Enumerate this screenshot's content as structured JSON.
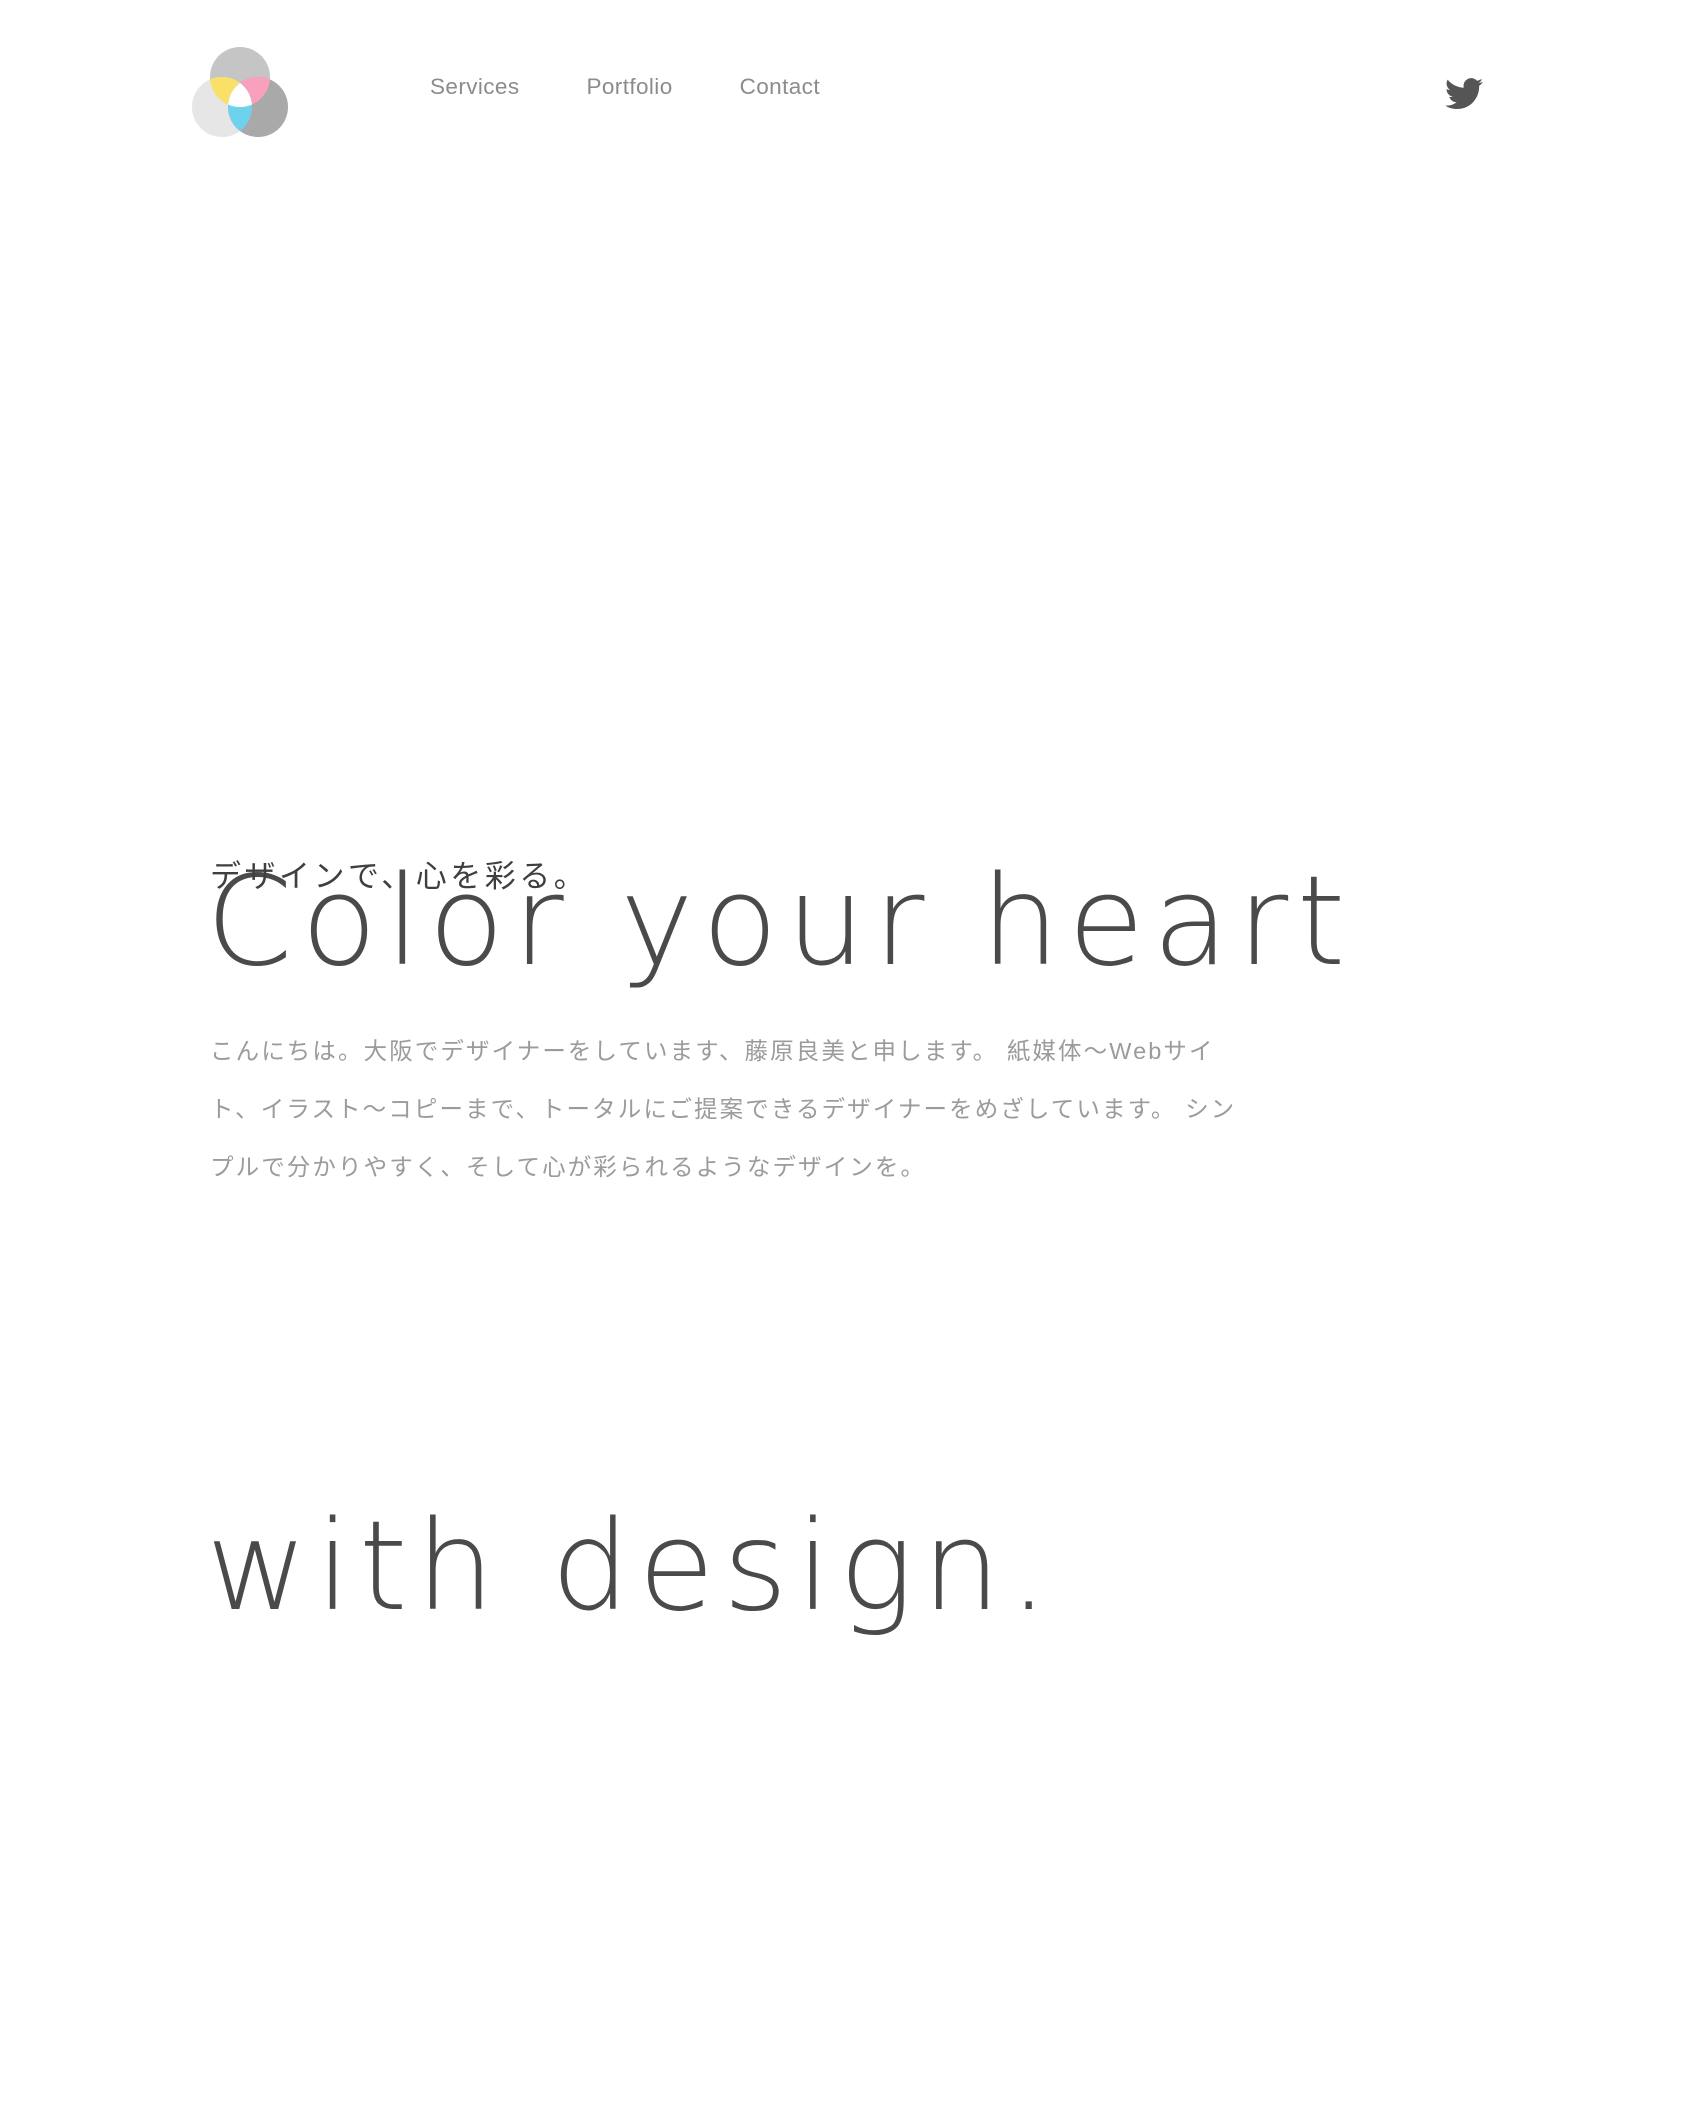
{
  "header": {
    "logo": {
      "name": "venn-circles-logo",
      "colors": {
        "circle_top": "#c5c5c5",
        "circle_left": "#e6e6e6",
        "circle_right": "#a9a9a9",
        "overlap_top_left": "#fadf68",
        "overlap_top_right": "#f9a0bd",
        "overlap_left_right": "#6fd2ec",
        "center": "#ffffff"
      }
    },
    "nav": [
      {
        "label": "Services",
        "name": "nav-item-services"
      },
      {
        "label": "Portfolio",
        "name": "nav-item-portfolio"
      },
      {
        "label": "Contact",
        "name": "nav-item-contact"
      }
    ],
    "social": {
      "label": "Twitter",
      "icon": "twitter-bird-icon",
      "color": "#555555"
    },
    "nav_color": "#8c8c8c"
  },
  "hero": {
    "title_line_1": "Color your heart",
    "title_line_2": "with design.",
    "title_color": "#4a4a4a",
    "subtitle": "デザインで、心を彩る。",
    "subtitle_color": "#3f3f3f",
    "body": "こんにちは。大阪でデザイナーをしています、藤原良美と申します。 紙媒体〜Webサイト、イラスト〜コピーまで、トータルにご提案できるデザイナーをめざしています。 シンプルで分かりやすく、そして心が彩られるようなデザインを。",
    "body_color": "#9b9b9b"
  },
  "page": {
    "background": "#ffffff"
  }
}
